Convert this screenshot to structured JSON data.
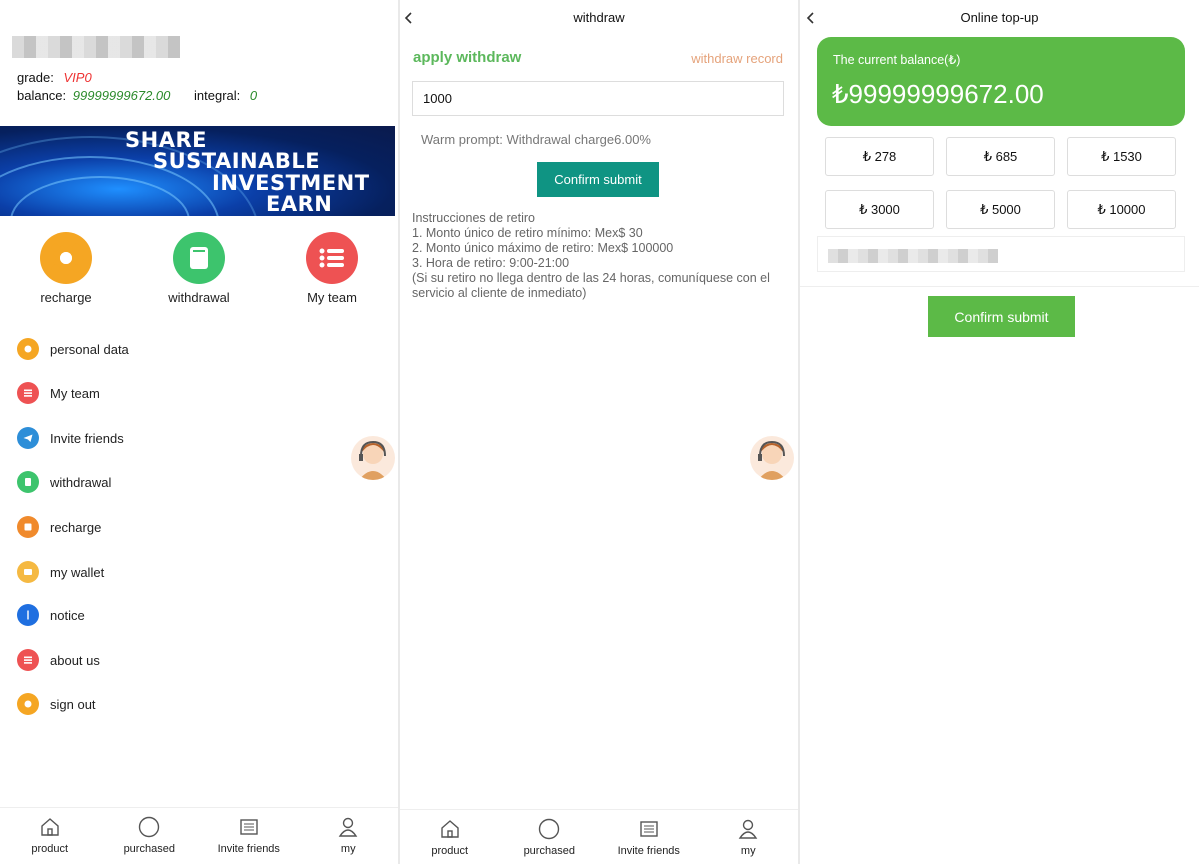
{
  "panel1": {
    "grade_label": "grade:",
    "grade_value": "VIP0",
    "balance_label": "balance:",
    "balance_value": "99999999672.00",
    "integral_label": "integral:",
    "integral_value": "0",
    "banner_lines": [
      "SHARE",
      "SUSTAINABLE",
      "INVESTMENT",
      "EARN"
    ],
    "quick": [
      {
        "label": "recharge",
        "icon": "gear-icon",
        "color": "#f5a623"
      },
      {
        "label": "withdrawal",
        "icon": "book-icon",
        "color": "#3dc46d"
      },
      {
        "label": "My team",
        "icon": "list-icon",
        "color": "#ee5253"
      }
    ],
    "menu": [
      {
        "label": "personal data",
        "icon": "gear-icon",
        "color": "#f5a623"
      },
      {
        "label": "My team",
        "icon": "list-icon",
        "color": "#ee5253"
      },
      {
        "label": "Invite friends",
        "icon": "telegram-icon",
        "color": "#2d8ed8"
      },
      {
        "label": "withdrawal",
        "icon": "book-icon",
        "color": "#3dc46d"
      },
      {
        "label": "recharge",
        "icon": "square-icon",
        "color": "#f08a2c"
      },
      {
        "label": "my wallet",
        "icon": "wallet-icon",
        "color": "#f5b942"
      },
      {
        "label": "notice",
        "icon": "bell-icon",
        "color": "#1f6fe0"
      },
      {
        "label": "about us",
        "icon": "list-icon",
        "color": "#ee5253"
      },
      {
        "label": "sign out",
        "icon": "gear-icon",
        "color": "#f5a623"
      }
    ]
  },
  "tabs": [
    "product",
    "purchased",
    "Invite friends",
    "my"
  ],
  "panel2": {
    "title": "withdraw",
    "apply_label": "apply withdraw",
    "record_label": "withdraw record",
    "amount_value": "1000",
    "prompt": "Warm prompt:  Withdrawal charge6.00%",
    "submit": "Confirm submit",
    "instructions": [
      "Instrucciones de retiro",
      "1. Monto único de retiro mínimo: Mex$ 30",
      "2. Monto único máximo de retiro: Mex$ 100000",
      "3. Hora de retiro: 9:00-21:00",
      "(Si su retiro no llega dentro de las 24 horas, comuníquese con el servicio al cliente de inmediato)"
    ]
  },
  "panel3": {
    "title": "Online top-up",
    "balance_title": "The current balance(₺)",
    "balance_value": "₺99999999672.00",
    "amounts": [
      "₺ 278",
      "₺ 685",
      "₺ 1530",
      "₺ 3000",
      "₺ 5000",
      "₺ 10000"
    ],
    "submit": "Confirm submit"
  },
  "colors": {
    "green": "#5cb85c",
    "teal": "#0f9483",
    "card_green": "#5cba47",
    "record": "#e5a37b"
  }
}
